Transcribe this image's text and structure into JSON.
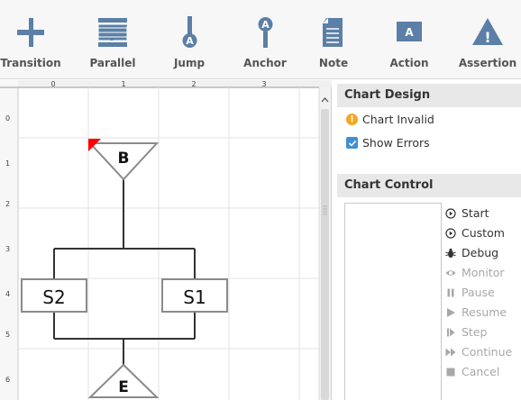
{
  "toolbar": {
    "items": [
      {
        "label": "Transition",
        "icon": "transition-icon"
      },
      {
        "label": "Parallel",
        "icon": "parallel-icon"
      },
      {
        "label": "Jump",
        "icon": "jump-icon",
        "glyph": "A"
      },
      {
        "label": "Anchor",
        "icon": "anchor-icon",
        "glyph": "A"
      },
      {
        "label": "Note",
        "icon": "note-icon"
      },
      {
        "label": "Action",
        "icon": "action-icon",
        "glyph": "A"
      },
      {
        "label": "Assertion",
        "icon": "assertion-icon",
        "glyph": "!"
      }
    ],
    "icon_color": "#5b7fa6"
  },
  "canvas": {
    "col_labels": [
      "0",
      "1",
      "2",
      "3"
    ],
    "row_labels": [
      "0",
      "1",
      "2",
      "3",
      "4",
      "5",
      "6"
    ],
    "begin_label": "B",
    "end_label": "E",
    "steps": [
      "S2",
      "S1"
    ],
    "error_color": "#ff0000"
  },
  "panel": {
    "design_title": "Chart Design",
    "invalid_text": "Chart Invalid",
    "show_errors_label": "Show Errors",
    "show_errors_checked": true,
    "control_title": "Chart Control",
    "controls": [
      {
        "label": "Start",
        "enabled": true,
        "icon": "play-circle-icon"
      },
      {
        "label": "Custom",
        "enabled": true,
        "icon": "play-circle-icon"
      },
      {
        "label": "Debug",
        "enabled": true,
        "icon": "bug-icon"
      },
      {
        "label": "Monitor",
        "enabled": false,
        "icon": "eye-icon"
      },
      {
        "label": "Pause",
        "enabled": false,
        "icon": "pause-icon"
      },
      {
        "label": "Resume",
        "enabled": false,
        "icon": "play-icon"
      },
      {
        "label": "Step",
        "enabled": false,
        "icon": "step-icon"
      },
      {
        "label": "Continue",
        "enabled": false,
        "icon": "fast-forward-icon"
      },
      {
        "label": "Cancel",
        "enabled": false,
        "icon": "stop-icon"
      }
    ]
  }
}
